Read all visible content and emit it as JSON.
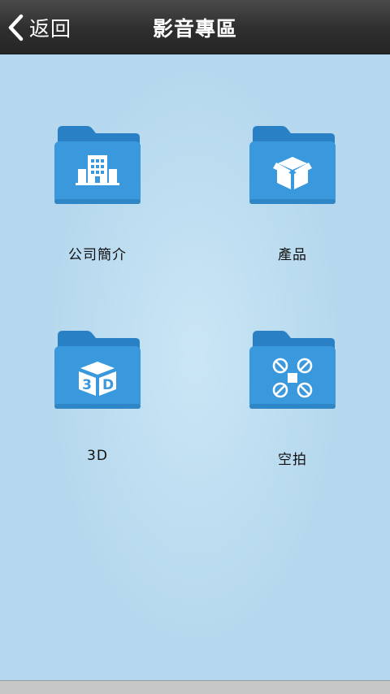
{
  "header": {
    "back_label": "返回",
    "title": "影音專區"
  },
  "folders": [
    {
      "label": "公司簡介",
      "icon": "building-icon"
    },
    {
      "label": "產品",
      "icon": "box-icon"
    },
    {
      "label": "3D",
      "icon": "3d-cube-icon"
    },
    {
      "label": "空拍",
      "icon": "drone-icon"
    }
  ],
  "colors": {
    "header_dark": "#2e2e2e",
    "background": "#bcdcef",
    "folder_blue": "#3a98dc",
    "folder_tab": "#2a80c4"
  }
}
